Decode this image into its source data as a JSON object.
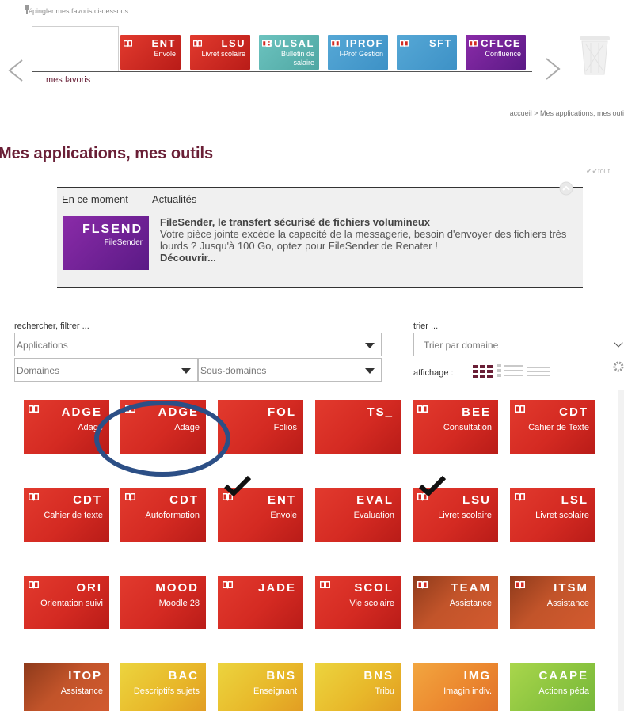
{
  "top": {
    "pin_hint": "épingler mes favoris ci-dessous",
    "favorites_label": "mes favoris"
  },
  "favorites": [
    {
      "code": "ENT",
      "sub": "Envole",
      "color": "red"
    },
    {
      "code": "LSU",
      "sub": "Livret scolaire",
      "color": "red"
    },
    {
      "code": "BULSAL",
      "sub": "Bulletin de salaire",
      "color": "teal"
    },
    {
      "code": "IPROF",
      "sub": "I-Prof Gestion",
      "color": "teal"
    },
    {
      "code": "SFT",
      "sub": "",
      "color": "teal"
    },
    {
      "code": "CFLCE",
      "sub": "Confluence",
      "color": "purple"
    }
  ],
  "breadcrumb": "accueil > Mes applications, mes outi",
  "page_title": "Mes applications, mes outils",
  "tout_label": "tout",
  "news": {
    "tab_now": "En ce moment",
    "tab_news": "Actualités",
    "app_code": "FLSEND",
    "app_sub": "FileSender",
    "headline": "FileSender, le transfert sécurisé de fichiers volumineux",
    "body": "Votre pièce jointe excède la capacité de la messagerie, besoin d'envoyer des fichiers très lourds ? Jusqu'à 100 Go, optez pour FileSender de Renater !",
    "link": "Découvrir..."
  },
  "filters": {
    "search_label": "rechercher, filtrer ...",
    "applications": "Applications",
    "domains": "Domaines",
    "subdomains": "Sous-domaines",
    "sort_label": "trier ...",
    "sort_value": "Trier par domaine",
    "display_label": "affichage :"
  },
  "apps": [
    {
      "code": "ADGE",
      "sub": "Adage",
      "color": "red",
      "book": true,
      "check": false
    },
    {
      "code": "ADGE",
      "sub": "Adage",
      "color": "red",
      "book": true,
      "check": false
    },
    {
      "code": "FOL",
      "sub": "Folios",
      "color": "red",
      "book": false,
      "check": false
    },
    {
      "code": "TS_",
      "sub": "",
      "color": "red",
      "book": false,
      "check": false
    },
    {
      "code": "BEE",
      "sub": "Consultation",
      "color": "red",
      "book": true,
      "check": false
    },
    {
      "code": "CDT",
      "sub": "Cahier de Texte",
      "color": "red",
      "book": true,
      "check": false
    },
    {
      "code": "CDT",
      "sub": "Cahier de texte",
      "color": "red",
      "book": true,
      "check": false
    },
    {
      "code": "CDT",
      "sub": "Autoformation",
      "color": "red",
      "book": true,
      "check": false
    },
    {
      "code": "ENT",
      "sub": "Envole",
      "color": "red",
      "book": true,
      "check": true
    },
    {
      "code": "EVAL",
      "sub": "Evaluation",
      "color": "red",
      "book": false,
      "check": false
    },
    {
      "code": "LSU",
      "sub": "Livret scolaire",
      "color": "red",
      "book": true,
      "check": true
    },
    {
      "code": "LSL",
      "sub": "Livret scolaire",
      "color": "red",
      "book": true,
      "check": false
    },
    {
      "code": "ORI",
      "sub": "Orientation suivi",
      "color": "red",
      "book": true,
      "check": false
    },
    {
      "code": "MOOD",
      "sub": "Moodle 28",
      "color": "red",
      "book": false,
      "check": false
    },
    {
      "code": "JADE",
      "sub": "",
      "color": "red",
      "book": true,
      "check": false
    },
    {
      "code": "SCOL",
      "sub": "Vie scolaire",
      "color": "red",
      "book": true,
      "check": false
    },
    {
      "code": "TEAM",
      "sub": "Assistance",
      "color": "brown",
      "book": true,
      "check": false
    },
    {
      "code": "ITSM",
      "sub": "Assistance",
      "color": "brown",
      "book": true,
      "check": false
    },
    {
      "code": "ITOP",
      "sub": "Assistance",
      "color": "brown",
      "book": false,
      "check": false
    },
    {
      "code": "BAC",
      "sub": "Descriptifs sujets",
      "color": "yellow",
      "book": false,
      "check": false
    },
    {
      "code": "BNS",
      "sub": "Enseignant",
      "color": "yellow",
      "book": false,
      "check": false
    },
    {
      "code": "BNS",
      "sub": "Tribu",
      "color": "yellow",
      "book": false,
      "check": false
    },
    {
      "code": "IMG",
      "sub": "Imagin indiv.",
      "color": "orange",
      "book": false,
      "check": false
    },
    {
      "code": "CAAPE",
      "sub": "Actions péda",
      "color": "green",
      "book": false,
      "check": false
    }
  ],
  "colors": {
    "title": "#6a1f36",
    "ring": "#2c4f86",
    "flsend": "#7a24a0"
  }
}
